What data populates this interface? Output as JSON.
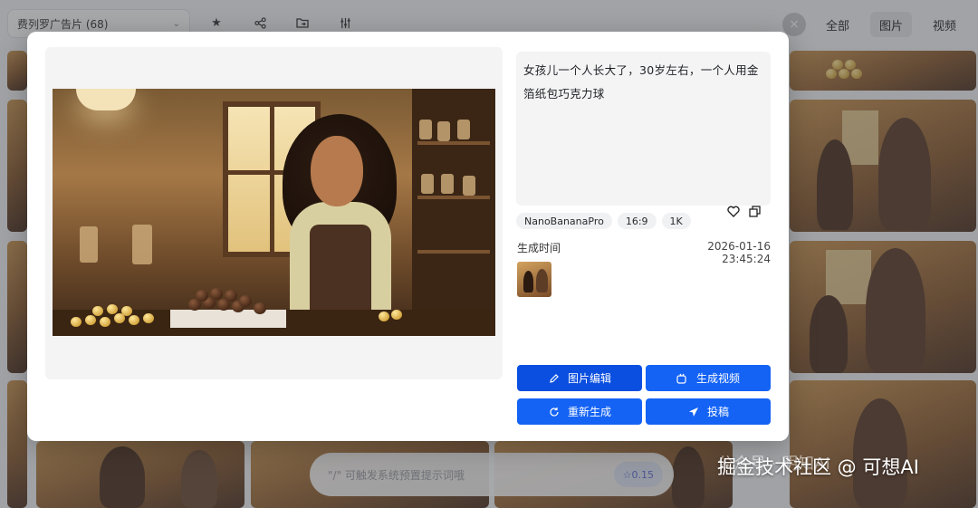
{
  "header": {
    "project_select": "费列罗广告片 (68)",
    "close_label": "×",
    "filters": [
      {
        "label": "全部",
        "active": false
      },
      {
        "label": "图片",
        "active": true
      },
      {
        "label": "视频",
        "active": false
      }
    ]
  },
  "icons": {
    "star": "star-icon",
    "share": "share-nodes-icon",
    "folder": "folder-move-icon",
    "settings": "sliders-icon"
  },
  "prompt_bar": {
    "placeholder": "\"/\" 可触发系统预置提示词哦",
    "credit": "☆0.15"
  },
  "watermark": {
    "ghost": "公众号 · 明知AI",
    "text": "掘金技术社区 @ 可想AI"
  },
  "detail": {
    "prompt": "女孩儿一个人长大了，30岁左右，一个人用金箔纸包巧克力球",
    "tags": [
      "NanoBananaPro",
      "16:9",
      "1K"
    ],
    "time_label": "生成时间",
    "time_value": "2026-01-16 23:45:24",
    "actions": {
      "edit": "图片编辑",
      "video": "生成视频",
      "regenerate": "重新生成",
      "submit": "投稿"
    }
  },
  "colors": {
    "primary": "#1463f5",
    "primary_dark": "#0a4fe0",
    "panel_bg": "#f4f4f5"
  }
}
